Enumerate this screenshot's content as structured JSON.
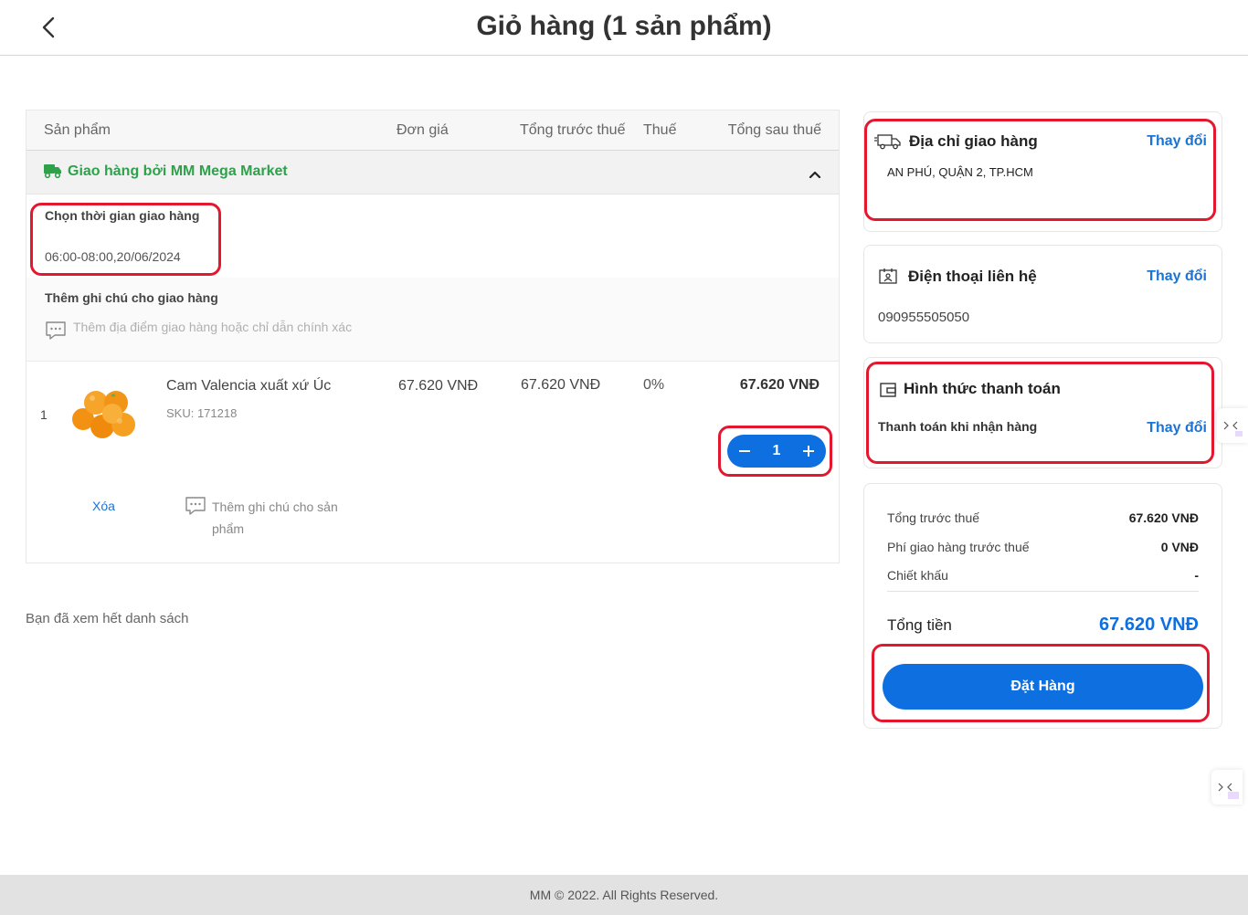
{
  "header": {
    "title": "Giỏ hàng (1 sản phẩm)"
  },
  "table": {
    "columns": [
      "Sản phẩm",
      "Đơn giá",
      "Tổng trước thuế",
      "Thuế",
      "Tổng sau thuế"
    ],
    "group_label": "Giao hàng bởi MM Mega Market",
    "delivery_slot": {
      "title": "Chọn thời gian giao hàng",
      "value": "06:00-08:00,20/06/2024"
    },
    "delivery_note": {
      "title": "Thêm ghi chú cho giao hàng",
      "placeholder": "Thêm địa điểm giao hàng hoặc chỉ dẫn chính xác"
    },
    "items": [
      {
        "index": "1",
        "name": "Cam Valencia xuất xứ Úc",
        "sku": "SKU: 171218",
        "unit_price": "67.620 VNĐ",
        "pre_tax": "67.620 VNĐ",
        "tax": "0%",
        "after_tax": "67.620 VNĐ",
        "quantity": "1",
        "delete_label": "Xóa",
        "note_label": "Thêm ghi chú cho sản phẩm"
      }
    ]
  },
  "list_end": "Bạn đã xem hết danh sách",
  "address": {
    "title": "Địa chỉ giao hàng",
    "change": "Thay đổi",
    "value": "AN PHÚ, QUẬN 2, TP.HCM"
  },
  "phone": {
    "title": "Điện thoại liên hệ",
    "change": "Thay đổi",
    "value": "090955505050"
  },
  "payment": {
    "title": "Hình thức thanh toán",
    "change": "Thay đổi",
    "value": "Thanh toán khi nhận hàng"
  },
  "summary": {
    "pre_tax_label": "Tổng trước thuế",
    "pre_tax_value": "67.620 VNĐ",
    "shipping_label": "Phí giao hàng trước thuế",
    "shipping_value": "0 VNĐ",
    "discount_label": "Chiết khấu",
    "discount_value": "-",
    "total_label": "Tổng tiền",
    "total_value": "67.620 VNĐ"
  },
  "order_button": "Đặt Hàng",
  "footer": "MM © 2022. All Rights Reserved.",
  "colors": {
    "primary": "#0d6fe0",
    "green": "#2ea14b",
    "highlight": "#e3182f"
  }
}
